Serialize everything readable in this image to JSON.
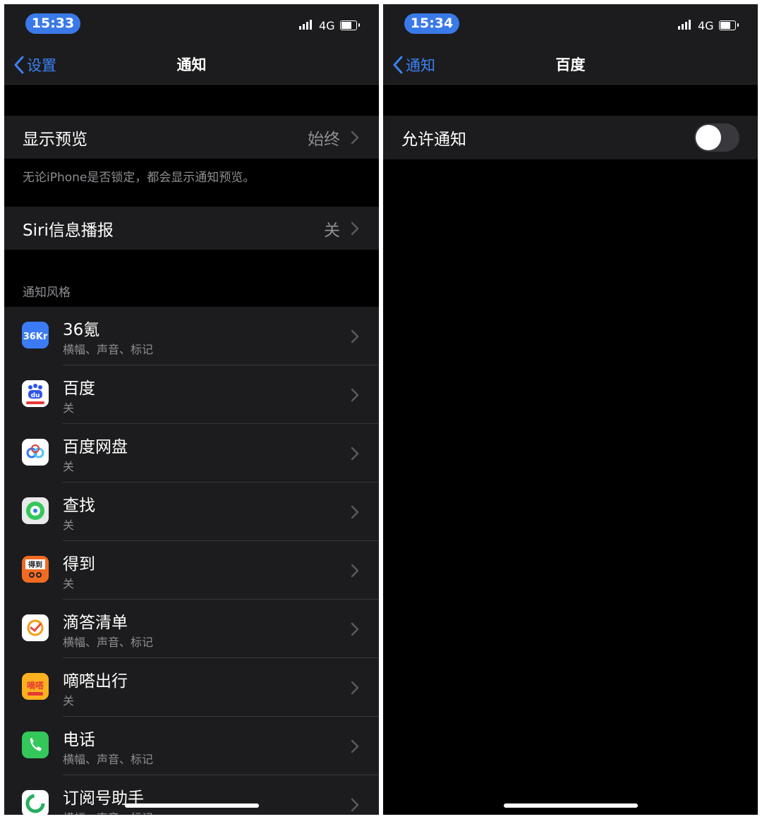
{
  "left": {
    "time": "15:33",
    "carrier": "4G",
    "back_label": "设置",
    "title": "通知",
    "show_preview": {
      "label": "显示预览",
      "value": "始终"
    },
    "preview_footnote": "无论iPhone是否锁定，都会显示通知预览。",
    "siri": {
      "label": "Siri信息播报",
      "value": "关"
    },
    "section_header": "通知风格",
    "apps": [
      {
        "name": "36氪",
        "sub": "横幅、声音、标记",
        "icon": "36kr-icon",
        "icon_text": "36Kr",
        "color": "#3b7cf6"
      },
      {
        "name": "百度",
        "sub": "关",
        "icon": "baidu-icon",
        "icon_text": "du",
        "color": "#ffffff"
      },
      {
        "name": "百度网盘",
        "sub": "关",
        "icon": "baidu-netdisk-icon",
        "icon_text": "",
        "color": "#ffffff"
      },
      {
        "name": "查找",
        "sub": "关",
        "icon": "find-my-icon",
        "icon_text": "",
        "color": "#e9e9ec"
      },
      {
        "name": "得到",
        "sub": "关",
        "icon": "dedao-icon",
        "icon_text": "得到",
        "color": "#f26b22"
      },
      {
        "name": "滴答清单",
        "sub": "横幅、声音、标记",
        "icon": "ticktick-icon",
        "icon_text": "",
        "color": "#ffffff"
      },
      {
        "name": "嘀嗒出行",
        "sub": "关",
        "icon": "dida-chuxing-icon",
        "icon_text": "嘀嗒",
        "color": "#ffb21e"
      },
      {
        "name": "电话",
        "sub": "横幅、声音、标记",
        "icon": "phone-icon",
        "icon_text": "",
        "color": "#34c759"
      },
      {
        "name": "订阅号助手",
        "sub": "横幅、声音、标记",
        "icon": "subscription-assistant-icon",
        "icon_text": "",
        "color": "#ffffff"
      }
    ]
  },
  "right": {
    "time": "15:34",
    "carrier": "4G",
    "back_label": "通知",
    "title": "百度",
    "allow": {
      "label": "允许通知",
      "on": false
    }
  },
  "colors": {
    "accent": "#3b82f6",
    "pill": "#3a79e8",
    "cell": "#1c1c1e",
    "secondary": "#8e8e93"
  }
}
